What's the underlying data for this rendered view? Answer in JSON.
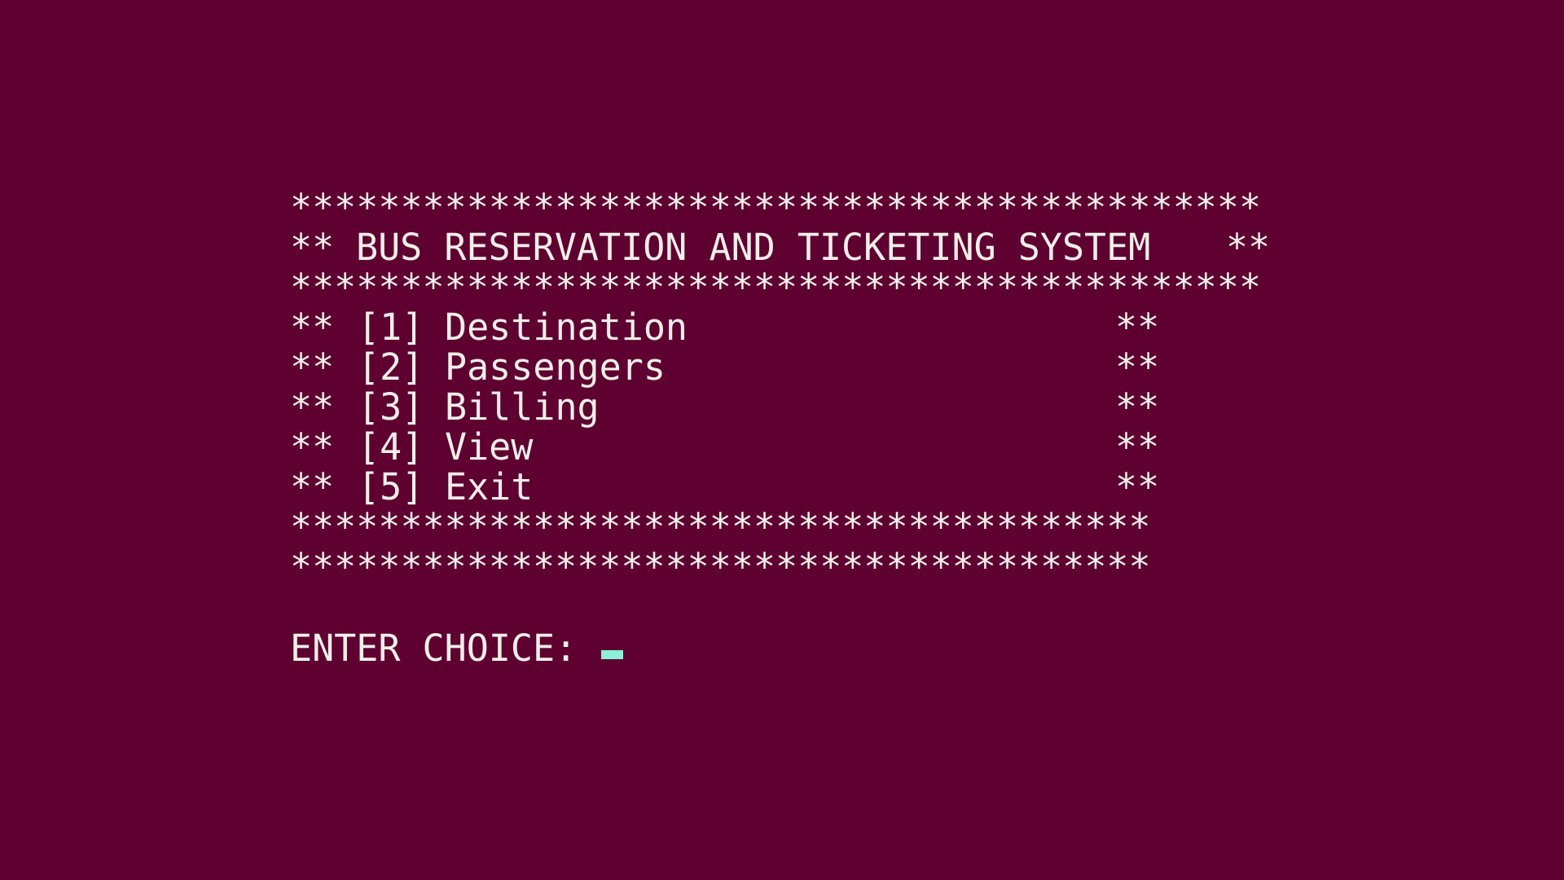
{
  "terminal": {
    "background_color": "#5e0030",
    "text_color": "#f2eee8",
    "cursor_color": "#8af0d7",
    "border_top": "********************************************",
    "border_mid": "********************************************",
    "border_bottom_1": "***************************************",
    "border_bottom_2": "***************************************",
    "frame_marker": "**",
    "title": "BUS RESERVATION AND TICKETING SYSTEM",
    "menu": [
      {
        "key": "[1]",
        "label": "Destination"
      },
      {
        "key": "[2]",
        "label": "Passengers"
      },
      {
        "key": "[3]",
        "label": "Billing"
      },
      {
        "key": "[4]",
        "label": "View"
      },
      {
        "key": "[5]",
        "label": "Exit"
      }
    ],
    "prompt": "ENTER CHOICE:"
  }
}
